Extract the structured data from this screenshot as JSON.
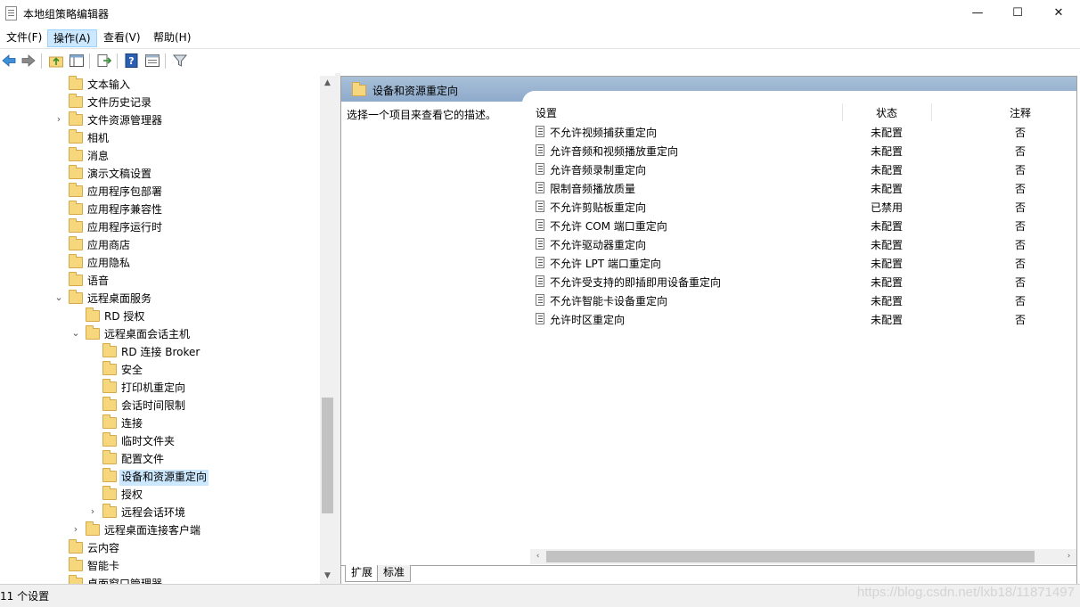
{
  "window": {
    "title": "本地组策略编辑器",
    "minimize": "—",
    "maximize": "☐",
    "close": "✕"
  },
  "menu": [
    {
      "label": "文件(F)"
    },
    {
      "label": "操作(A)"
    },
    {
      "label": "查看(V)"
    },
    {
      "label": "帮助(H)"
    }
  ],
  "tree": [
    {
      "label": "文本输入"
    },
    {
      "label": "文件历史记录"
    },
    {
      "label": "文件资源管理器"
    },
    {
      "label": "相机"
    },
    {
      "label": "消息"
    },
    {
      "label": "演示文稿设置"
    },
    {
      "label": "应用程序包部署"
    },
    {
      "label": "应用程序兼容性"
    },
    {
      "label": "应用程序运行时"
    },
    {
      "label": "应用商店"
    },
    {
      "label": "应用隐私"
    },
    {
      "label": "语音"
    },
    {
      "label": "远程桌面服务"
    },
    {
      "label": "RD 授权"
    },
    {
      "label": "远程桌面会话主机"
    },
    {
      "label": "RD 连接 Broker"
    },
    {
      "label": "安全"
    },
    {
      "label": "打印机重定向"
    },
    {
      "label": "会话时间限制"
    },
    {
      "label": "连接"
    },
    {
      "label": "临时文件夹"
    },
    {
      "label": "配置文件"
    },
    {
      "label": "设备和资源重定向"
    },
    {
      "label": "授权"
    },
    {
      "label": "远程会话环境"
    },
    {
      "label": "远程桌面连接客户端"
    },
    {
      "label": "云内容"
    },
    {
      "label": "智能卡"
    },
    {
      "label": "桌面窗口管理器"
    }
  ],
  "tree_expanders": {
    "collapsed": "›",
    "expanded": "⌄"
  },
  "right_pane": {
    "header_title": "设备和资源重定向",
    "description": "选择一个项目来查看它的描述。",
    "columns": {
      "setting": "设置",
      "state": "状态",
      "comment": "注释"
    }
  },
  "policies": [
    {
      "name": "不允许视频捕获重定向",
      "state": "未配置",
      "comment": "否"
    },
    {
      "name": "允许音频和视频播放重定向",
      "state": "未配置",
      "comment": "否"
    },
    {
      "name": "允许音频录制重定向",
      "state": "未配置",
      "comment": "否"
    },
    {
      "name": "限制音频播放质量",
      "state": "未配置",
      "comment": "否"
    },
    {
      "name": "不允许剪贴板重定向",
      "state": "已禁用",
      "comment": "否"
    },
    {
      "name": "不允许 COM 端口重定向",
      "state": "未配置",
      "comment": "否"
    },
    {
      "name": "不允许驱动器重定向",
      "state": "未配置",
      "comment": "否"
    },
    {
      "name": "不允许 LPT 端口重定向",
      "state": "未配置",
      "comment": "否"
    },
    {
      "name": "不允许受支持的即插即用设备重定向",
      "state": "未配置",
      "comment": "否"
    },
    {
      "name": "不允许智能卡设备重定向",
      "state": "未配置",
      "comment": "否"
    },
    {
      "name": "允许时区重定向",
      "state": "未配置",
      "comment": "否"
    }
  ],
  "tabs": [
    {
      "label": "扩展"
    },
    {
      "label": "标准"
    }
  ],
  "status": {
    "text": "11 个设置",
    "watermark": "https://blog.csdn.net/lxb18/11871497"
  },
  "scroll_arrows": {
    "up": "▲",
    "down": "▼",
    "left": "‹",
    "right": "›"
  }
}
